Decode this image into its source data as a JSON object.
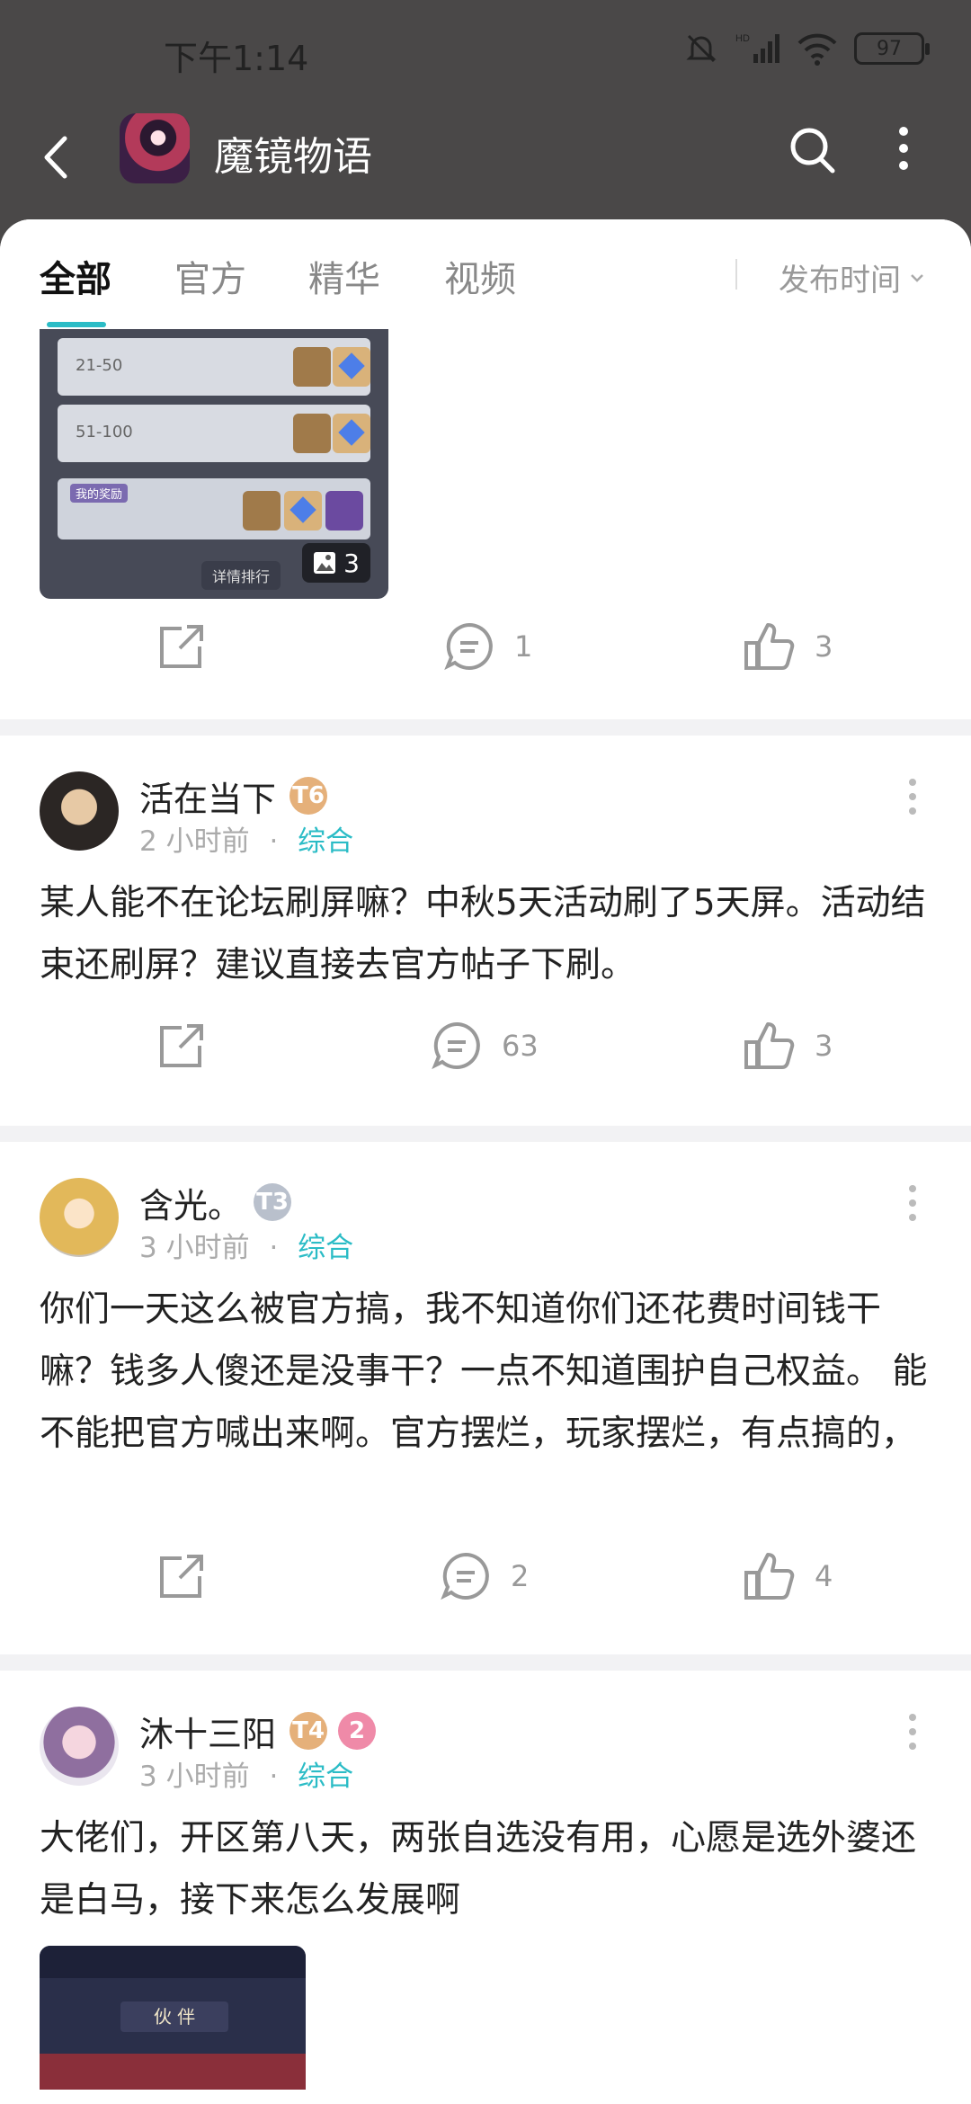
{
  "status_bar": {
    "time": "下午1:14",
    "battery": "97"
  },
  "header": {
    "title": "魔镜物语"
  },
  "tabs": [
    {
      "label": "全部"
    },
    {
      "label": "官方"
    },
    {
      "label": "精华"
    },
    {
      "label": "视频"
    }
  ],
  "sort": {
    "label": "发布时间"
  },
  "colors": {
    "accent": "#2bbcc6",
    "header_bg": "#4a4848"
  },
  "first_post": {
    "image": {
      "rows": [
        "21-50",
        "51-100"
      ],
      "my_reward": "我的奖励",
      "rank_btn": "详情排行",
      "image_count": "3"
    },
    "comments": "1",
    "likes": "3"
  },
  "posts": [
    {
      "username": "活在当下",
      "badges": [
        "T6"
      ],
      "time": "2 小时前",
      "category": "综合",
      "text": "某人能不在论坛刷屏嘛？中秋5天活动刷了5天屏。活动结束还刷屏？建议直接去官方帖子下刷。",
      "comments": "63",
      "likes": "3"
    },
    {
      "username": "含光。",
      "badges": [
        "T3"
      ],
      "time": "3 小时前",
      "category": "综合",
      "text": "你们一天这么被官方搞，我不知道你们还花费时间钱干嘛？钱多人傻还是没事干？一点不知道围护自己权益。 能不能把官方喊出来啊。官方摆烂，玩家摆烂，有点搞的，",
      "comments": "2",
      "likes": "4"
    },
    {
      "username": "沐十三阳",
      "badges": [
        "T4",
        "2"
      ],
      "time": "3 小时前",
      "category": "综合",
      "text": "大佬们，开区第八天，两张自选没有用，心愿是选外婆还是白马，接下来怎么发展啊",
      "image": {
        "label": "伙 伴"
      }
    }
  ]
}
